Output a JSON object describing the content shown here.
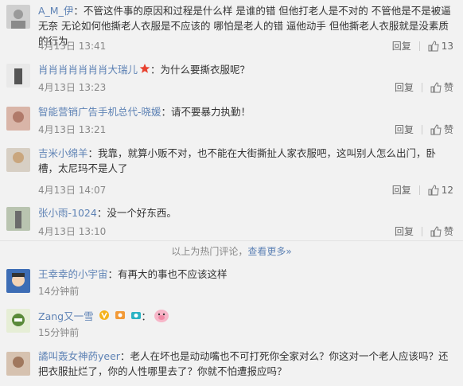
{
  "comments": [
    {
      "user": "A_M_伊",
      "text": "不管这件事的原因和过程是什么样 是谁的错  但他打老人是不对的 不管他是不是被逼无奈 无论如何他撕老人衣服是不应该的 哪怕是老人的错 逼他动手 但他撕老人衣服就是没素质的行为",
      "time": "4月13日 13:41",
      "reply": "回复",
      "likes": "13"
    },
    {
      "user": "肖肖肖肖肖肖肖大瑞儿",
      "text": "为什么要撕衣服呢？",
      "time": "4月13日 13:23",
      "reply": "回复",
      "likes": "赞"
    },
    {
      "user": "智能营销广告手机总代-晓媛",
      "text": "请不要暴力执勤！",
      "time": "4月13日 13:21",
      "reply": "回复",
      "likes": "赞"
    },
    {
      "user": "吉米小绵羊",
      "text": "我靠，就算小贩不对，也不能在大街撕扯人家衣服吧，这叫别人怎么出门，卧槽，太尼玛不是人了",
      "time": "4月13日 14:07",
      "reply": "回复",
      "likes": "12"
    },
    {
      "user": "张小雨-1024",
      "text": "没一个好东西。",
      "time": "4月13日 13:10",
      "reply": "回复",
      "likes": "赞"
    }
  ],
  "divider": {
    "text": "以上为热门评论，",
    "more": "查看更多»"
  },
  "recent": [
    {
      "user": "王幸幸的小宇宙",
      "text": "有再大的事也不应该这样",
      "time": "14分钟前"
    },
    {
      "user": "Zang又一雪",
      "text": "",
      "time": "15分钟前"
    },
    {
      "user": "譎叫轰女神菂yeer",
      "text": "老人在坏也是动动嘴也不可打死你全家对么？你这对一个老人应该吗？还把衣服扯烂了，你的人性哪里去了？你就不怕遭报应吗？",
      "time": ""
    }
  ]
}
